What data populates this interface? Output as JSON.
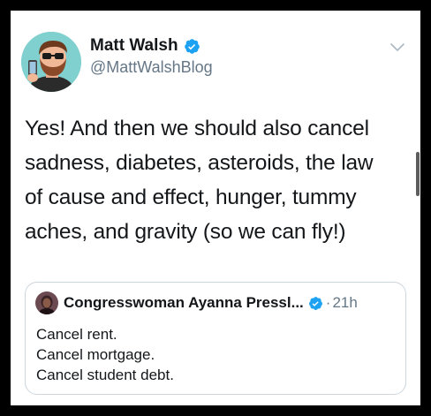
{
  "author": {
    "name": "Matt Walsh",
    "handle": "@MattWalshBlog",
    "avatar_icon": "cartoon-avatar-with-phone",
    "verified_icon": "verified-badge-icon",
    "verified_color": "#1da1f2"
  },
  "tweet": {
    "lines": [
      "Yes! And then we should also cancel",
      "sadness, diabetes, asteroids, the law",
      "of cause and effect, hunger, tummy",
      "aches, and gravity (so we can fly!)"
    ]
  },
  "quoted": {
    "name": "Congresswoman Ayanna Pressl...",
    "separator": "·",
    "time": "21h",
    "lines": [
      "Cancel rent.",
      "Cancel mortgage.",
      "Cancel student debt."
    ]
  },
  "menu_icon": "chevron-down-icon",
  "colors": {
    "text": "#14171a",
    "secondary": "#657786",
    "border": "#ccd6dd",
    "frame": "#000000"
  }
}
